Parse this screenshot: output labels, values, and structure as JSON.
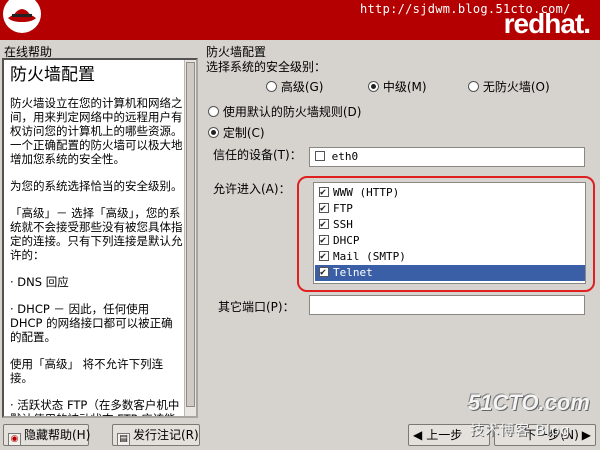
{
  "banner": {
    "watermark_url": "http://sjdwm.blog.51cto.com/",
    "brand": "redhat."
  },
  "help": {
    "label": "在线帮助",
    "title": "防火墙配置",
    "paragraphs": [
      "防火墙设立在您的计算机和网络之间，用来判定网络中的远程用户有权访问您的计算机上的哪些资源。一个正确配置的防火墙可以极大地增加您系统的安全性。",
      "为您的系统选择恰当的安全级别。",
      "「高级」－ 选择「高级」，您的系统就不会接受那些没有被您具体指定的连接。只有下列连接是默认允许的：",
      "· DNS 回应",
      "· DHCP － 因此，任何使用 DHCP 的网络接口都可以被正确的配置。",
      "使用「高级」 将不允许下列连接。",
      "· 活跃状态 FTP（在多数客户机中默认使用的被动状态 FTP 应该能够正常工作）"
    ]
  },
  "config": {
    "section_label": "防火墙配置",
    "level_label": "选择系统的安全级别：",
    "levels": [
      {
        "label": "高级(G)",
        "selected": false
      },
      {
        "label": "中级(M)",
        "selected": true
      },
      {
        "label": "无防火墙(O)",
        "selected": false
      }
    ],
    "rule_options": [
      {
        "label": "使用默认的防火墙规则(D)",
        "selected": false
      },
      {
        "label": "定制(C)",
        "selected": true
      }
    ],
    "trusted_label": "信任的设备(T)：",
    "trusted_devices": [
      {
        "label": "eth0",
        "checked": false
      }
    ],
    "allow_label": "允许进入(A)：",
    "allow_services": [
      {
        "label": "WWW (HTTP)",
        "checked": true
      },
      {
        "label": "FTP",
        "checked": true
      },
      {
        "label": "SSH",
        "checked": true
      },
      {
        "label": "DHCP",
        "checked": true
      },
      {
        "label": "Mail (SMTP)",
        "checked": true
      },
      {
        "label": "Telnet",
        "checked": true,
        "selected": true
      }
    ],
    "other_ports_label": "其它端口(P)：",
    "other_ports_value": ""
  },
  "footer": {
    "hide_help": "隐藏帮助(H)",
    "release_notes": "发行注记(R)",
    "back": "上一步",
    "next": "下一步(N)",
    "watermark_51cto": "51CTO.com",
    "watermark_blog": "技术博客 Blog"
  },
  "colors": {
    "banner": "#b40000",
    "selection": "#3b5fa6",
    "highlight_ring": "#e02020"
  }
}
